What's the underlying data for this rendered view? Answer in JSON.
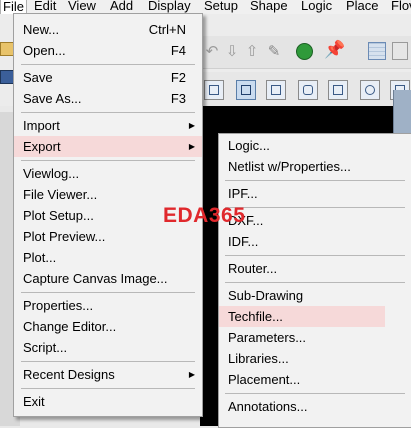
{
  "menubar": {
    "items": [
      "File",
      "Edit",
      "View",
      "Add",
      "Display",
      "Setup",
      "Shape",
      "Logic",
      "Place",
      "Flov"
    ],
    "active": "File"
  },
  "file_menu": {
    "items": [
      {
        "label": "New...",
        "shortcut": "Ctrl+N"
      },
      {
        "label": "Open...",
        "shortcut": "F4"
      },
      {
        "label": "Save",
        "shortcut": "F2"
      },
      {
        "label": "Save As...",
        "shortcut": "F3"
      },
      {
        "label": "Import",
        "shortcut": ""
      },
      {
        "label": "Export",
        "shortcut": ""
      },
      {
        "label": "Viewlog...",
        "shortcut": ""
      },
      {
        "label": "File Viewer...",
        "shortcut": ""
      },
      {
        "label": "Plot Setup...",
        "shortcut": ""
      },
      {
        "label": "Plot Preview...",
        "shortcut": ""
      },
      {
        "label": "Plot...",
        "shortcut": ""
      },
      {
        "label": "Capture Canvas Image...",
        "shortcut": ""
      },
      {
        "label": "Properties...",
        "shortcut": ""
      },
      {
        "label": "Change Editor...",
        "shortcut": ""
      },
      {
        "label": "Script...",
        "shortcut": ""
      },
      {
        "label": "Recent Designs",
        "shortcut": ""
      },
      {
        "label": "Exit",
        "shortcut": ""
      }
    ],
    "highlighted": "Export"
  },
  "export_submenu": {
    "items": [
      {
        "label": "Logic..."
      },
      {
        "label": "Netlist w/Properties..."
      },
      {
        "label": "IPF..."
      },
      {
        "label": "DXF..."
      },
      {
        "label": "IDF..."
      },
      {
        "label": "Router..."
      },
      {
        "label": "Sub-Drawing"
      },
      {
        "label": "Techfile..."
      },
      {
        "label": "Parameters..."
      },
      {
        "label": "Libraries..."
      },
      {
        "label": "Placement..."
      },
      {
        "label": "Annotations..."
      }
    ],
    "highlighted": "Techfile..."
  },
  "watermark": "EDA365",
  "colors": {
    "highlight": "#f6d9d9",
    "watermark": "#e0282c",
    "canvas": "#000000"
  }
}
